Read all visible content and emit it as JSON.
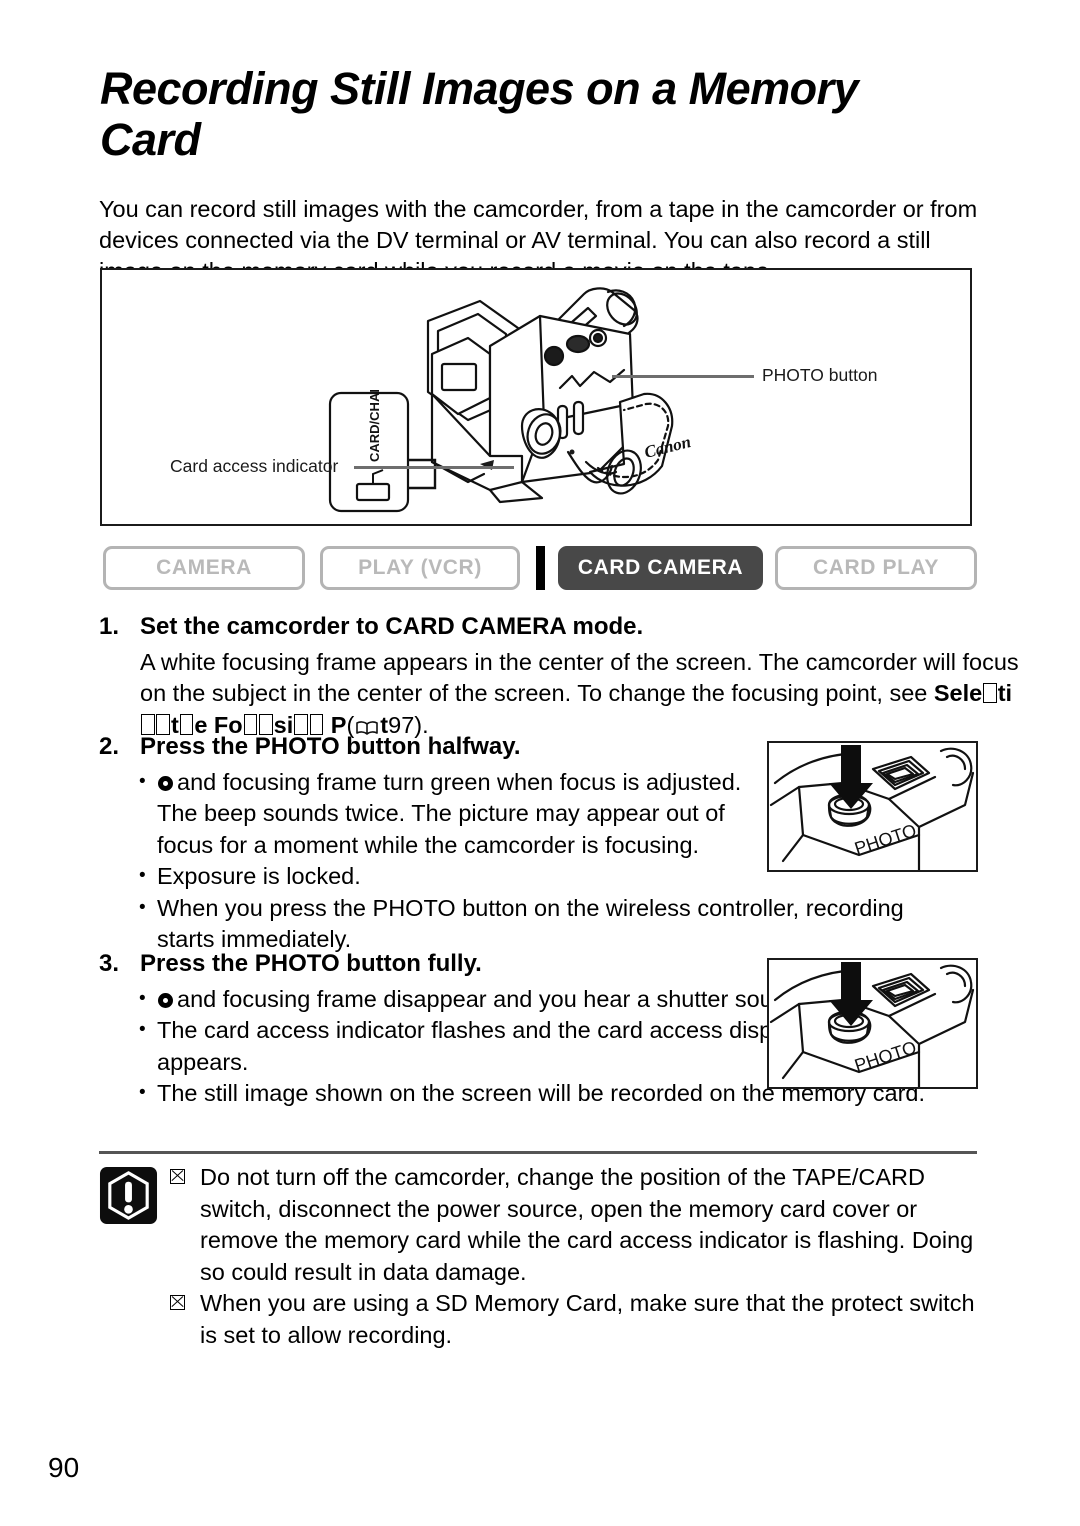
{
  "page": {
    "number": "90",
    "title": "Recording Still Images on a Memory Card",
    "intro": "You can record still images with the camcorder, from a tape in the camcorder or from devices connected via the DV terminal or AV terminal. You can also record a still image on the memory card while you record a movie on the tape."
  },
  "figure": {
    "photo_button_label": "PHOTO button",
    "card_access_label": "Card access indicator",
    "callout_text": "CARD/CHARGE",
    "brand": "Canon"
  },
  "mode_tabs": [
    {
      "label": "CAMERA",
      "active": false
    },
    {
      "label": "PLAY (VCR)",
      "active": false
    },
    {
      "label": "CARD CAMERA",
      "active": true
    },
    {
      "label": "CARD PLAY",
      "active": false
    }
  ],
  "steps": {
    "step1": {
      "number": "1.",
      "heading": "Set the camcorder to CARD CAMERA mode.",
      "body_a": "A white focusing frame appears in the center of the screen. The camcorder will focus on the subject in the center of the screen. To change the focusing point, see ",
      "ref_bold_1": "Sele",
      "ref_bold_2": "ti",
      "ref_bold_3": "e Fo",
      "ref_bold_4": "si",
      "ref_bold_5": "P",
      "ref_bold_6": "t",
      "ref_page": "97",
      "ref_close": ")."
    },
    "step2": {
      "number": "2.",
      "heading": "Press the PHOTO button halfway.",
      "bullets": [
        "and focusing frame turn green when focus is adjusted. The beep sounds twice. The picture may appear out of focus for a moment while the camcorder is focusing.",
        "Exposure is locked.",
        "When you press the PHOTO button on the wireless controller, recording starts immediately."
      ]
    },
    "step3": {
      "number": "3.",
      "heading": "Press the PHOTO button fully.",
      "bullets": [
        "and focusing frame disappear and you hear a shutter sound.",
        "The card access indicator flashes and the card access display appears.",
        "The still image shown on the screen will be recorded on the memory card."
      ]
    }
  },
  "thumbnails": {
    "photo_label": "PHOTO"
  },
  "notes": [
    "Do not turn off the camcorder, change the position of the TAPE/CARD switch, disconnect the power source, open the memory card cover or remove the memory card while the card access indicator is flashing. Doing so could result in data damage.",
    "When you are using a SD Memory Card, make sure that the protect switch is set to allow recording."
  ],
  "colors": {
    "active_tab_bg": "#484848",
    "inactive_tab_border": "#b4b4b4",
    "inactive_tab_text": "#b9b9b9",
    "leader_line": "#6e6e6e",
    "rule": "#555555"
  }
}
